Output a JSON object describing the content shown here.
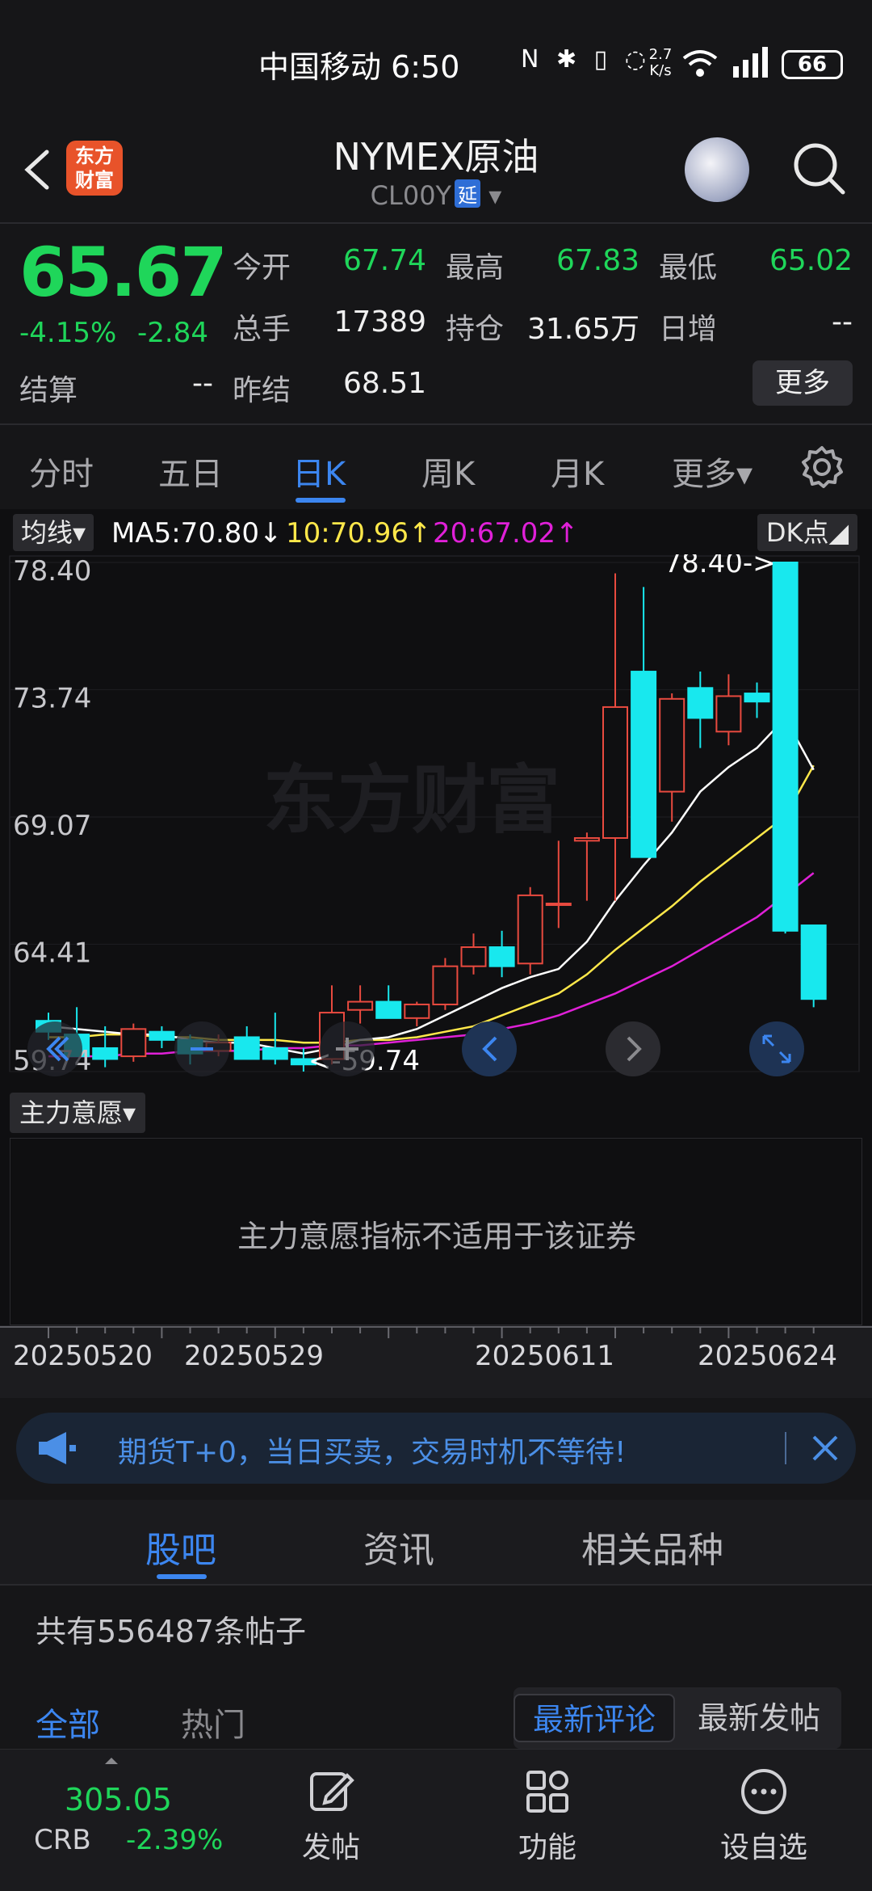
{
  "status": {
    "carrier_time": "中国移动 6:50",
    "speed_top": "2.7",
    "speed_bottom": "K/s",
    "battery": "66"
  },
  "header": {
    "logo_line1": "东方",
    "logo_line2": "财富",
    "title": "NYMEX原油",
    "code": "CL00Y",
    "code_badge": "延"
  },
  "quote": {
    "price": "65.67",
    "change_pct": "-4.15%",
    "change": "-2.84",
    "settle_label": "结算",
    "settle_value": "--",
    "open_label": "今开",
    "open_value": "67.74",
    "high_label": "最高",
    "high_value": "67.83",
    "low_label": "最低",
    "low_value": "65.02",
    "volume_label": "总手",
    "volume_value": "17389",
    "oi_label": "持仓",
    "oi_value": "31.65万",
    "daily_inc_label": "日增",
    "daily_inc_value": "--",
    "prev_settle_label": "昨结",
    "prev_settle_value": "68.51",
    "more_button": "更多"
  },
  "tabs": {
    "items": [
      "分时",
      "五日",
      "日K",
      "周K",
      "月K",
      "更多▾"
    ],
    "active": "日K"
  },
  "ma_bar": {
    "button": "均线▾",
    "ma5": "MA5:70.80↓",
    "ma10": "10:70.96↑",
    "ma20": "20:67.02↑",
    "dk_button": "DK点◢",
    "ma5_color": "#ffffff",
    "ma10_color": "#ffe84a",
    "ma20_color": "#e020d8"
  },
  "chart_data": {
    "type": "candlestick",
    "y_ticks": [
      "78.40",
      "73.74",
      "69.07",
      "64.41",
      "59.74"
    ],
    "ylim": [
      59.74,
      78.4
    ],
    "max_label": "78.40->",
    "min_label": "<-59.74",
    "watermark": "东方财富",
    "x_labels": [
      "20250520",
      "20250529",
      "20250611",
      "20250624"
    ],
    "up_color": "#e84a3f",
    "down_color": "#18e8ee",
    "candles": [
      {
        "o": 61.6,
        "h": 61.9,
        "l": 60.9,
        "c": 61.2
      },
      {
        "o": 61.1,
        "h": 62.1,
        "l": 60.3,
        "c": 60.3
      },
      {
        "o": 60.6,
        "h": 61.4,
        "l": 59.9,
        "c": 60.2
      },
      {
        "o": 60.3,
        "h": 61.5,
        "l": 60.1,
        "c": 61.3
      },
      {
        "o": 61.2,
        "h": 61.4,
        "l": 60.6,
        "c": 60.9
      },
      {
        "o": 60.9,
        "h": 61.1,
        "l": 60.0,
        "c": 60.4
      },
      {
        "o": 60.5,
        "h": 61.1,
        "l": 60.3,
        "c": 60.8
      },
      {
        "o": 61.0,
        "h": 61.4,
        "l": 60.3,
        "c": 60.2
      },
      {
        "o": 60.6,
        "h": 61.9,
        "l": 60.0,
        "c": 60.2
      },
      {
        "o": 60.2,
        "h": 60.6,
        "l": 59.74,
        "c": 60.0
      },
      {
        "o": 60.2,
        "h": 62.9,
        "l": 60.0,
        "c": 61.9
      },
      {
        "o": 62.0,
        "h": 62.9,
        "l": 61.5,
        "c": 62.3
      },
      {
        "o": 62.3,
        "h": 62.9,
        "l": 61.7,
        "c": 61.7
      },
      {
        "o": 61.7,
        "h": 62.3,
        "l": 61.4,
        "c": 62.2
      },
      {
        "o": 62.2,
        "h": 63.9,
        "l": 62.0,
        "c": 63.6
      },
      {
        "o": 63.6,
        "h": 64.8,
        "l": 63.3,
        "c": 64.3
      },
      {
        "o": 64.3,
        "h": 64.9,
        "l": 63.2,
        "c": 63.6
      },
      {
        "o": 63.7,
        "h": 66.5,
        "l": 63.3,
        "c": 66.2
      },
      {
        "o": 65.9,
        "h": 68.2,
        "l": 65.0,
        "c": 65.9
      },
      {
        "o": 68.2,
        "h": 68.5,
        "l": 66.0,
        "c": 68.3
      },
      {
        "o": 68.3,
        "h": 78.0,
        "l": 66.0,
        "c": 73.1
      },
      {
        "o": 74.4,
        "h": 77.5,
        "l": 70.9,
        "c": 67.6
      },
      {
        "o": 70.0,
        "h": 73.6,
        "l": 68.9,
        "c": 73.4
      },
      {
        "o": 73.8,
        "h": 74.4,
        "l": 71.6,
        "c": 72.7
      },
      {
        "o": 72.2,
        "h": 74.3,
        "l": 71.7,
        "c": 73.5
      },
      {
        "o": 73.6,
        "h": 74.0,
        "l": 72.7,
        "c": 73.3
      },
      {
        "o": 78.4,
        "h": 78.4,
        "l": 64.8,
        "c": 64.9
      },
      {
        "o": 65.1,
        "h": 65.1,
        "l": 62.1,
        "c": 62.4
      }
    ],
    "ma5": [
      61.4,
      61.3,
      61.2,
      61.1,
      61.1,
      60.9,
      60.8,
      60.8,
      60.6,
      60.4,
      60.6,
      60.9,
      61.0,
      61.3,
      61.8,
      62.3,
      62.8,
      63.2,
      63.5,
      64.5,
      66.0,
      67.3,
      68.5,
      70.0,
      70.9,
      71.6,
      72.7,
      70.8
    ],
    "ma10": [
      61.0,
      61.0,
      61.1,
      61.1,
      61.0,
      61.0,
      60.9,
      60.9,
      60.9,
      60.8,
      60.8,
      60.9,
      60.9,
      61.0,
      61.2,
      61.4,
      61.8,
      62.2,
      62.6,
      63.3,
      64.2,
      65.0,
      65.8,
      66.7,
      67.5,
      68.3,
      69.1,
      70.96
    ],
    "ma20": [
      60.3,
      60.3,
      60.3,
      60.4,
      60.4,
      60.5,
      60.5,
      60.5,
      60.6,
      60.6,
      60.7,
      60.7,
      60.8,
      60.9,
      61.0,
      61.1,
      61.3,
      61.5,
      61.8,
      62.2,
      62.6,
      63.1,
      63.6,
      64.2,
      64.8,
      65.4,
      66.2,
      67.02
    ]
  },
  "indicator": {
    "button": "主力意愿▾",
    "message": "主力意愿指标不适用于该证券"
  },
  "banner": {
    "text": "期货T+0，当日买卖，交易时机不等待!"
  },
  "section_tabs": {
    "items": [
      "股吧",
      "资讯",
      "相关品种"
    ],
    "active": "股吧"
  },
  "posts": {
    "count_text": "共有556487条帖子",
    "filter_all": "全部",
    "filter_hot": "热门",
    "sort_latest_comment": "最新评论",
    "sort_latest_post": "最新发帖"
  },
  "bottom_nav": {
    "crb_value": "305.05",
    "crb_name": "CRB",
    "crb_change": "-2.39%",
    "post": "发帖",
    "function": "功能",
    "watchlist": "设自选"
  }
}
